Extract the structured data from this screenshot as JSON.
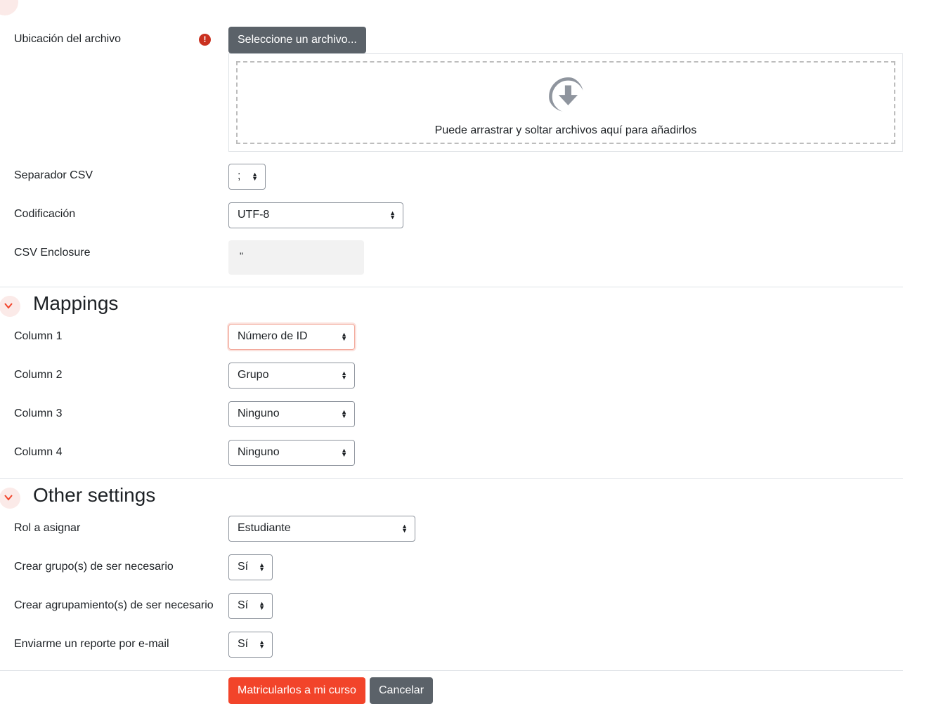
{
  "file": {
    "label": "Ubicación del archivo",
    "required_glyph": "!",
    "button": "Seleccione un archivo...",
    "drop_text": "Puede arrastrar y soltar archivos aquí para añadirlos",
    "drop_icon": "download-arrow-circle-icon"
  },
  "csv_separator": {
    "label": "Separador CSV",
    "value": ";"
  },
  "encoding": {
    "label": "Codificación",
    "value": "UTF-8"
  },
  "csv_enclosure": {
    "label": "CSV Enclosure",
    "value": "\""
  },
  "mappings": {
    "title": "Mappings",
    "columns": [
      {
        "label": "Column 1",
        "value": "Número de ID"
      },
      {
        "label": "Column 2",
        "value": "Grupo"
      },
      {
        "label": "Column 3",
        "value": "Ninguno"
      },
      {
        "label": "Column 4",
        "value": "Ninguno"
      }
    ]
  },
  "other": {
    "title": "Other settings",
    "role": {
      "label": "Rol a asignar",
      "value": "Estudiante"
    },
    "create_groups": {
      "label": "Crear grupo(s) de ser necesario",
      "value": "Sí"
    },
    "create_groupings": {
      "label": "Crear agrupamiento(s) de ser necesario",
      "value": "Sí"
    },
    "email_report": {
      "label": "Enviarme un reporte por e-mail",
      "value": "Sí"
    }
  },
  "actions": {
    "submit": "Matricularlos a mi curso",
    "cancel": "Cancelar"
  },
  "colors": {
    "primary": "#f2442a",
    "secondary": "#5b6269",
    "required": "#ca3120"
  }
}
